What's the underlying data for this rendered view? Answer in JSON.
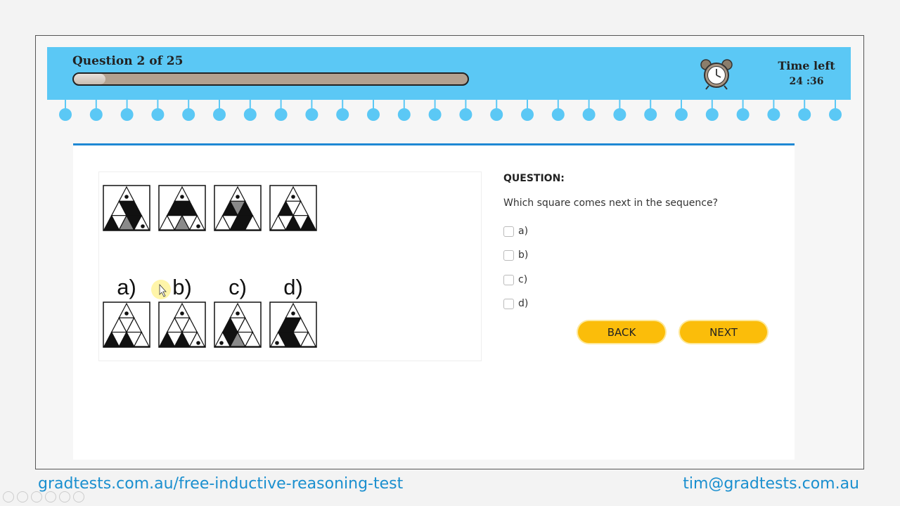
{
  "header": {
    "question_counter": "Question 2 of 25",
    "progress_fraction": 0.08,
    "time_label": "Time left",
    "time_value": "24 :36"
  },
  "puzzle": {
    "option_labels": [
      "a)",
      "b)",
      "c)",
      "d)"
    ]
  },
  "question": {
    "heading": "QUESTION:",
    "text": "Which square comes next in the sequence?",
    "options": [
      "a)",
      "b)",
      "c)",
      "d)"
    ]
  },
  "buttons": {
    "back": "BACK",
    "next": "NEXT"
  },
  "footer": {
    "left_link": "gradtests.com.au/free-inductive-reasoning-test",
    "right_email": "tim@gradtests.com.au"
  },
  "colors": {
    "header": "#5bc8f5",
    "accent": "#1e88d4",
    "button": "#fbbd0a"
  }
}
